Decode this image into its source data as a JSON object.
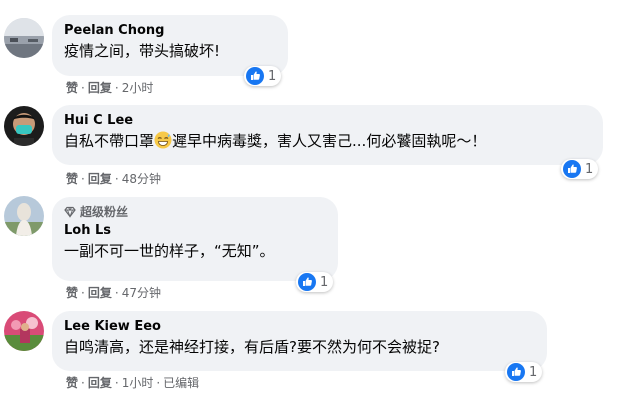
{
  "colors": {
    "bubble": "#f0f2f5",
    "meta": "#65676b",
    "like_blue": "#1877f2"
  },
  "comments": [
    {
      "author": "Peelan Chong",
      "text": "疫情之间，带头搞破坏!",
      "actions": {
        "like": "赞",
        "reply": "回复",
        "time": "2小时"
      },
      "reaction_count": "1"
    },
    {
      "author": "Hui C Lee",
      "text_before_emoji": "自私不帶口罩",
      "emoji": "grinning-sweat-emoji",
      "text_after_emoji": "遲早中病毒獎，害人又害己...何必饕固執呢～！",
      "actions": {
        "like": "赞",
        "reply": "回复",
        "time": "48分钟"
      },
      "reaction_count": "1"
    },
    {
      "badge": "超级粉丝",
      "author": "Loh Ls",
      "text": "一副不可一世的样子，“无知”。",
      "actions": {
        "like": "赞",
        "reply": "回复",
        "time": "47分钟"
      },
      "reaction_count": "1"
    },
    {
      "author": "Lee Kiew Eeo",
      "text": "自鸣清高，还是神经打接，有后盾?要不然为何不会被捉?",
      "actions": {
        "like": "赞",
        "reply": "回复",
        "time": "1小时",
        "edited": "已编辑"
      },
      "reaction_count": "1"
    }
  ]
}
